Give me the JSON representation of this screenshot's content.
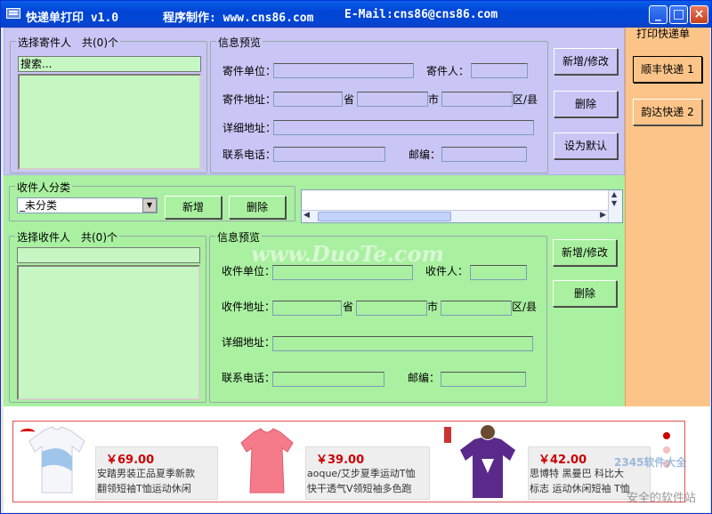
{
  "titlebar": {
    "app_title": "快递单打印 v1.0",
    "author": "程序制作: www.cns86.com",
    "email": "E-Mail:cns86@cns86.com",
    "minimize": "_",
    "maximize": "□",
    "close": "×"
  },
  "sender": {
    "list_label": "选择寄件人　共(0)个",
    "search_value": "搜索...",
    "preview_label": "信息预览",
    "company_label": "寄件单位：",
    "person_label": "寄件人：",
    "address_label": "寄件地址：",
    "province": "省",
    "city": "市",
    "county": "区/县",
    "detail_label": "详细地址：",
    "phone_label": "联系电话：",
    "zip_label": "邮编：",
    "btn_add": "新增/修改",
    "btn_delete": "删除",
    "btn_default": "设为默认"
  },
  "print": {
    "title": "打印快递单",
    "btn_sf": "顺丰快递 1",
    "btn_yunda": "韵达快递 2"
  },
  "category": {
    "label": "收件人分类",
    "selected": "_未分类",
    "btn_add": "新增",
    "btn_delete": "删除"
  },
  "receiver": {
    "list_label": "选择收件人　共(0)个",
    "preview_label": "信息预览",
    "company_label": "收件单位：",
    "person_label": "收件人：",
    "address_label": "收件地址：",
    "province": "省",
    "city": "市",
    "county": "区/县",
    "detail_label": "详细地址：",
    "phone_label": "联系电话：",
    "zip_label": "邮编：",
    "btn_add": "新增/修改",
    "btn_delete": "删除"
  },
  "watermark": "www.DuoTe.com",
  "ads": [
    {
      "price": "￥69.00",
      "line1": "安踏男装正品夏季新款",
      "line2": "翻领短袖T恤运动休闲"
    },
    {
      "price": "￥39.00",
      "line1": "aoque/艾步夏季运动T恤",
      "line2": "快干透气V领短袖多色跑"
    },
    {
      "price": "￥42.00",
      "line1": "思博特 黑曼巴 科比大",
      "line2": "标志 运动休闲短袖 T恤"
    }
  ],
  "brand_watermark": "2345软件大全",
  "brand_sub": "安全的软件站",
  "colors": {
    "purple": "#c9c6f5",
    "green": "#a9f0a0",
    "orange": "#fcc488",
    "titlebar": "#0045d6"
  }
}
